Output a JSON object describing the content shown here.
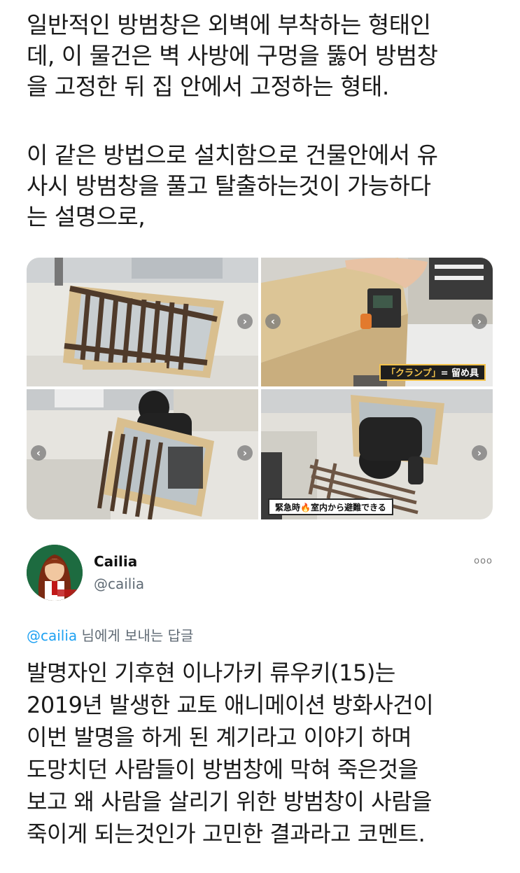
{
  "tweet": {
    "paragraph1": [
      "일반적인 방범창은 외벽에 부착하는 형태인",
      "데, 이 물건은 벽 사방에 구멍을 뚫어 방범창",
      "을 고정한 뒤 집 안에서 고정하는 형태."
    ],
    "paragraph2": [
      "이 같은 방법으로 설치함으로 건물안에서 유",
      "사시 방범창을 풀고 탈출하는것이 가능하다",
      "는 설명으로,"
    ]
  },
  "media": {
    "caption_clamp_highlight": "「クランプ」",
    "caption_clamp_rest": "= 留め具",
    "caption_emergency_a": "緊急時",
    "caption_emergency_flame": "🔥",
    "caption_emergency_b": "室内から避難できる",
    "nav_next": "›",
    "nav_prev": "‹"
  },
  "reply": {
    "display_name": "Cailia",
    "handle": "@cailia",
    "more_label": "ooo",
    "replying_mention": "@cailia",
    "replying_suffix": " 님에게 보내는 답글",
    "lines": [
      "발명자인 기후현 이나가키 류우키(15)는",
      "2019년 발생한 교토 애니메이션 방화사건이",
      "이번 발명을 하게 된 계기라고 이야기 하며",
      "도망치던 사람들이 방범창에 막혀 죽은것을",
      "보고 왜 사람을 살리기 위한 방범창이 사람을",
      "죽이게 되는것인가 고민한 결과라고 코멘트."
    ]
  },
  "colors": {
    "link": "#1da1f2",
    "muted": "#606b75",
    "wood": "#d9bf8f",
    "bars": "#5a4332"
  },
  "icons": [
    "chevron-right-icon",
    "chevron-left-icon",
    "more-icon",
    "avatar-image"
  ]
}
